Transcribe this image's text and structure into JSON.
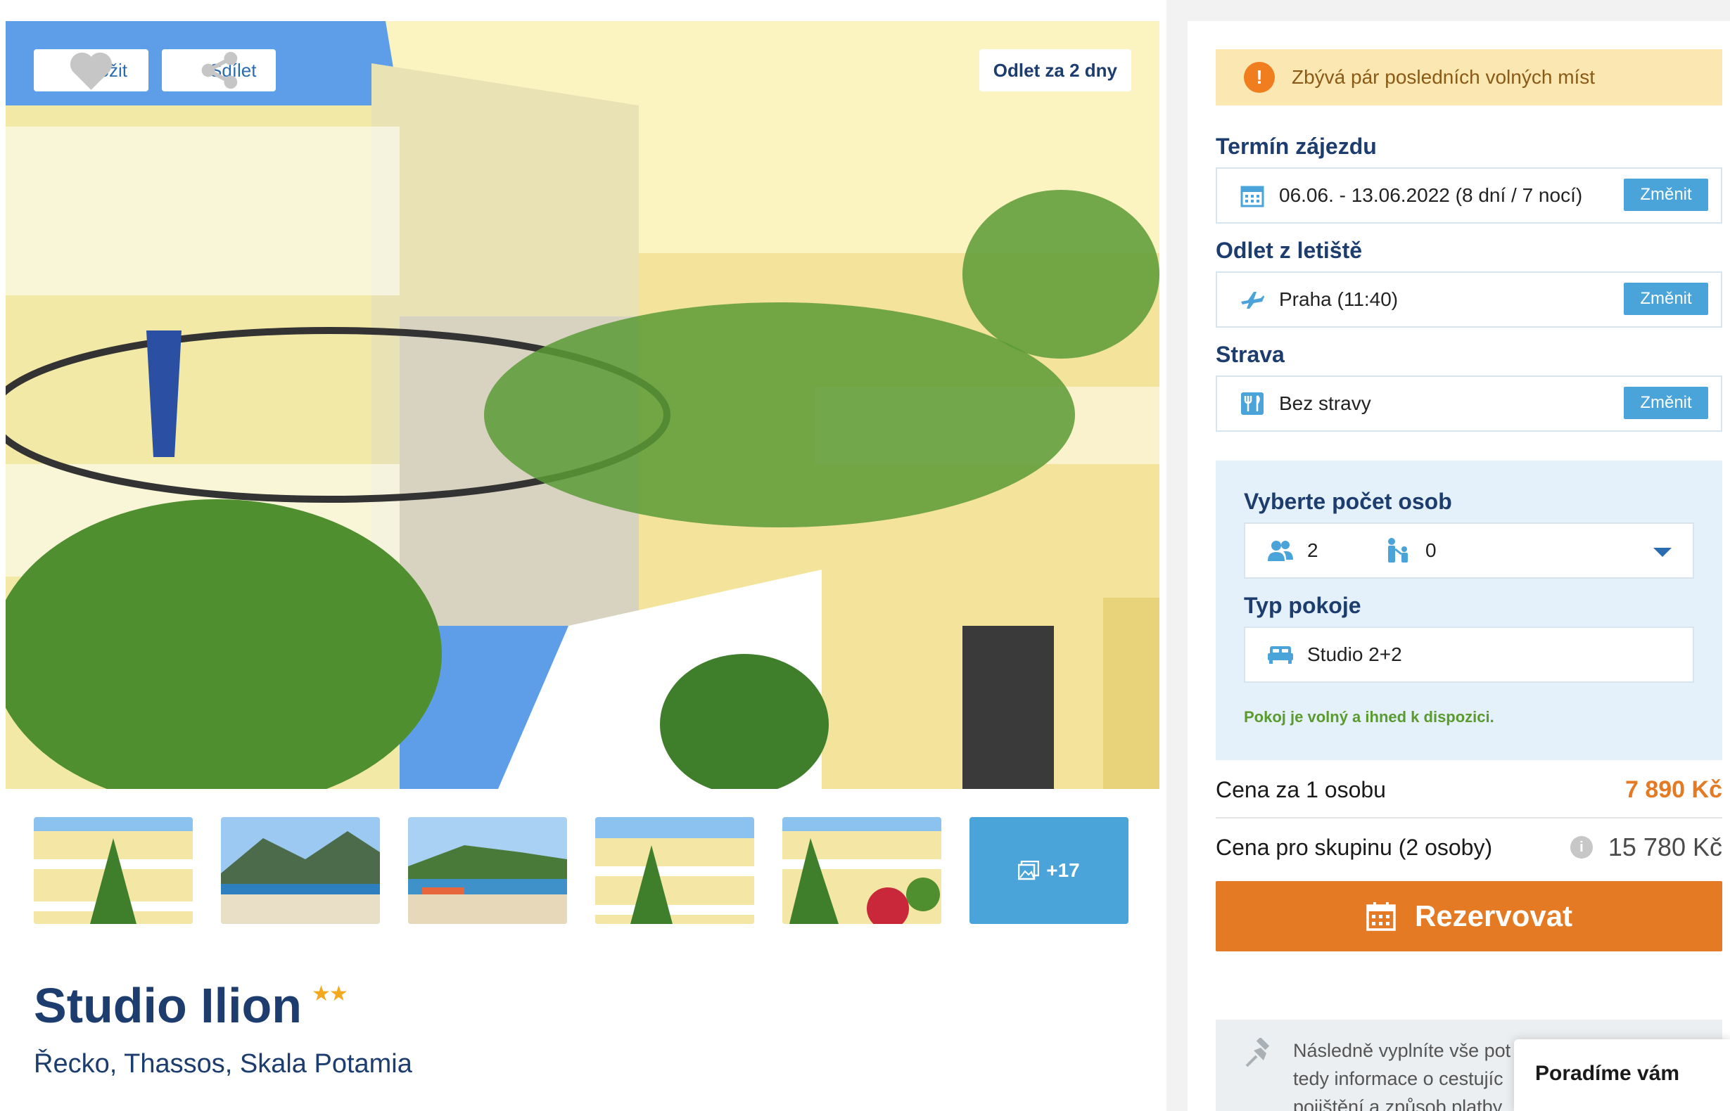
{
  "gallery": {
    "save_label": "Uložit",
    "share_label": "Sdílet",
    "departure_badge": "Odlet za 2 dny",
    "more_photos": "+17"
  },
  "hotel": {
    "name": "Studio Ilion",
    "stars": "★★",
    "location": "Řecko, Thassos, Skala Potamia"
  },
  "booking": {
    "alert": "Zbývá pár posledních volných míst",
    "term_label": "Termín zájezdu",
    "term_value": "06.06. - 13.06.2022 (8 dní / 7 nocí)",
    "airport_label": "Odlet z letiště",
    "airport_value": "Praha (11:40)",
    "board_label": "Strava",
    "board_value": "Bez stravy",
    "change_label": "Změnit",
    "persons_label": "Vyberte počet osob",
    "adults": "2",
    "children": "0",
    "room_label": "Typ pokoje",
    "room_value": "Studio 2+2",
    "room_available": "Pokoj je volný a ihned k dispozici.",
    "price_person_label": "Cena za 1 osobu",
    "price_person_value": "7 890 Kč",
    "price_group_label": "Cena pro skupinu (2 osoby)",
    "price_group_value": "15 780 Kč",
    "reserve_label": "Rezervovat",
    "note_line1": "Následně vyplníte vše pot",
    "note_line2": "tedy informace o cestujíc",
    "note_line3": "pojištění a způsob platby.",
    "popup": "Poradíme vám"
  },
  "colors": {
    "brand_dark": "#1c3d6e",
    "accent_blue": "#4aa4d9",
    "accent_orange": "#e57a24",
    "alert_bg": "#fbe7b2"
  }
}
